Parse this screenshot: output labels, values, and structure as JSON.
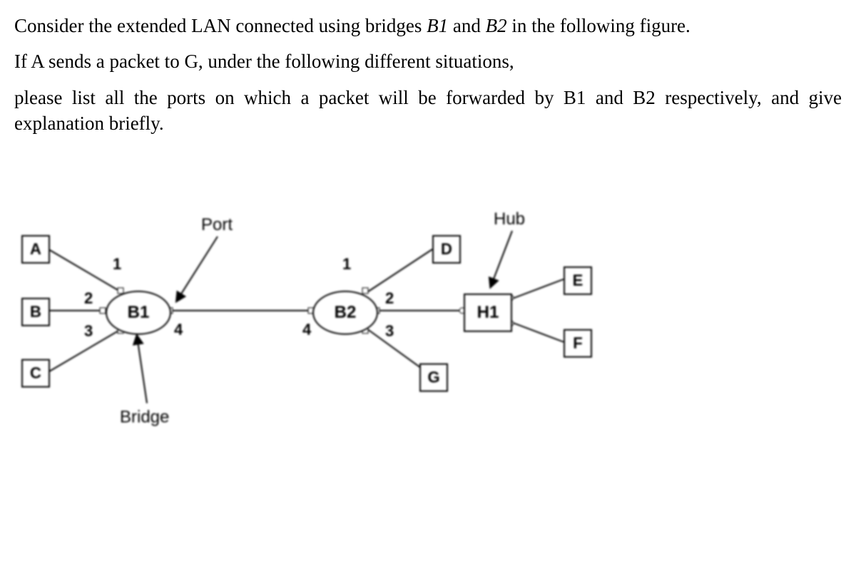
{
  "problem": {
    "p1a": "Consider the extended LAN connected using bridges ",
    "p1b": "B1",
    "p1c": " and ",
    "p1d": "B2",
    "p1e": " in the following figure.",
    "p2": "If A sends a packet to G, under the following different situations,",
    "p3": "please list all the ports on which a packet will be forwarded by B1 and B2 respectively, and give explanation briefly."
  },
  "labels": {
    "port": "Port",
    "hub": "Hub",
    "bridge": "Bridge"
  },
  "nodes": {
    "A": "A",
    "B": "B",
    "C": "C",
    "D": "D",
    "E": "E",
    "F": "F",
    "G": "G",
    "B1": "B1",
    "B2": "B2",
    "H1": "H1"
  },
  "ports": {
    "b1_1": "1",
    "b1_2": "2",
    "b1_3": "3",
    "b1_4": "4",
    "b2_1": "1",
    "b2_2": "2",
    "b2_3": "3",
    "b2_4": "4"
  },
  "chart_data": {
    "type": "network-diagram",
    "devices": {
      "bridges": [
        {
          "name": "B1",
          "ports": [
            1,
            2,
            3,
            4
          ]
        },
        {
          "name": "B2",
          "ports": [
            1,
            2,
            3,
            4
          ]
        }
      ],
      "hubs": [
        {
          "name": "H1"
        }
      ],
      "hosts": [
        "A",
        "B",
        "C",
        "D",
        "E",
        "F",
        "G"
      ]
    },
    "links": [
      {
        "from": "A",
        "to": "B1",
        "to_port": 1
      },
      {
        "from": "B",
        "to": "B1",
        "to_port": 2
      },
      {
        "from": "C",
        "to": "B1",
        "to_port": 3
      },
      {
        "from": "B1",
        "from_port": 4,
        "to": "B2",
        "to_port": 4
      },
      {
        "from": "D",
        "to": "B2",
        "to_port": 1
      },
      {
        "from": "G",
        "to": "B2",
        "to_port": 3
      },
      {
        "from": "B2",
        "from_port": 2,
        "to": "H1"
      },
      {
        "from": "E",
        "to": "H1"
      },
      {
        "from": "F",
        "to": "H1"
      }
    ],
    "annotations": [
      {
        "text": "Port",
        "points_to": "B1 port 4"
      },
      {
        "text": "Bridge",
        "points_to": "B1"
      },
      {
        "text": "Hub",
        "points_to": "H1"
      }
    ]
  }
}
